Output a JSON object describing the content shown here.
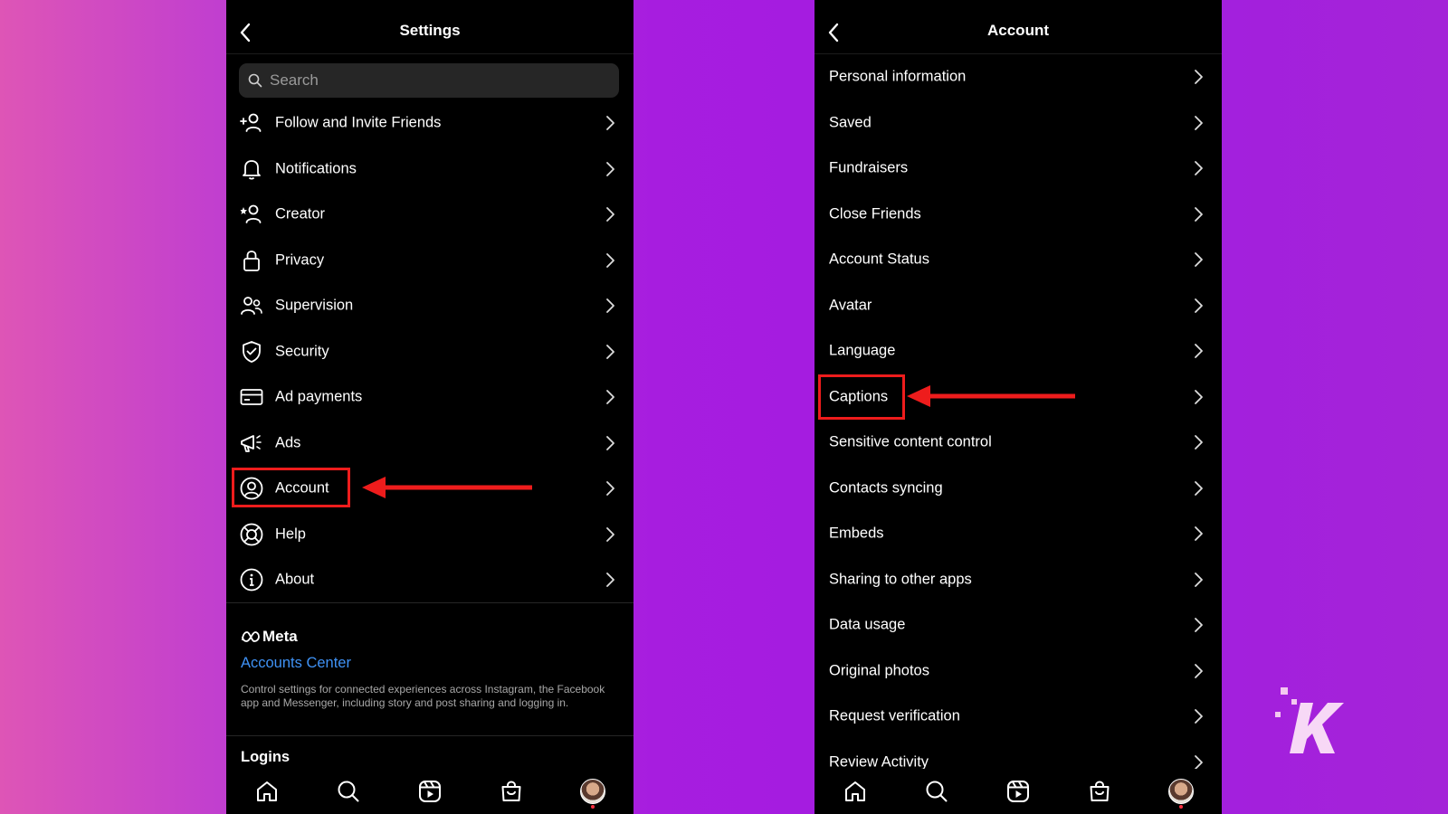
{
  "left_screen": {
    "title": "Settings",
    "search": {
      "placeholder": "Search"
    },
    "items": [
      {
        "label": "Follow and Invite Friends",
        "icon": "add-person-icon"
      },
      {
        "label": "Notifications",
        "icon": "bell-icon"
      },
      {
        "label": "Creator",
        "icon": "creator-star-icon"
      },
      {
        "label": "Privacy",
        "icon": "lock-icon"
      },
      {
        "label": "Supervision",
        "icon": "supervision-icon"
      },
      {
        "label": "Security",
        "icon": "shield-icon"
      },
      {
        "label": "Ad payments",
        "icon": "card-icon"
      },
      {
        "label": "Ads",
        "icon": "megaphone-icon"
      },
      {
        "label": "Account",
        "icon": "account-circle-icon"
      },
      {
        "label": "Help",
        "icon": "lifebuoy-icon"
      },
      {
        "label": "About",
        "icon": "info-icon"
      }
    ],
    "meta": {
      "logo": "Meta",
      "accounts_center": "Accounts Center",
      "description": "Control settings for connected experiences across Instagram, the Facebook app and Messenger, including story and post sharing and logging in."
    },
    "logins_title": "Logins",
    "highlighted_item": "Account"
  },
  "right_screen": {
    "title": "Account",
    "items": [
      {
        "label": "Personal information"
      },
      {
        "label": "Saved"
      },
      {
        "label": "Fundraisers"
      },
      {
        "label": "Close Friends"
      },
      {
        "label": "Account Status"
      },
      {
        "label": "Avatar"
      },
      {
        "label": "Language"
      },
      {
        "label": "Captions"
      },
      {
        "label": "Sensitive content control"
      },
      {
        "label": "Contacts syncing"
      },
      {
        "label": "Embeds"
      },
      {
        "label": "Sharing to other apps"
      },
      {
        "label": "Data usage"
      },
      {
        "label": "Original photos"
      },
      {
        "label": "Request verification"
      },
      {
        "label": "Review Activity"
      }
    ],
    "highlighted_item": "Captions"
  },
  "tabbar": [
    "home-icon",
    "search-icon",
    "reels-icon",
    "shop-icon",
    "profile-avatar"
  ],
  "colors": {
    "annotation_red": "#ee1c1c",
    "link_blue": "#3f92f5",
    "panel_bg": "#000000"
  },
  "watermark": "K"
}
